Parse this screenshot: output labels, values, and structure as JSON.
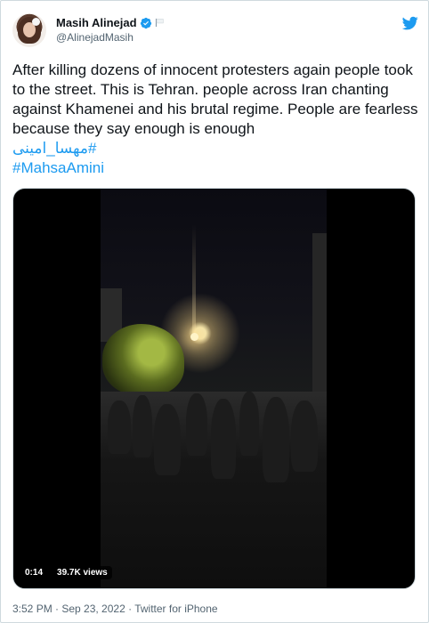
{
  "author": {
    "display_name": "Masih Alinejad",
    "handle": "@AlinejadMasih",
    "verified": true
  },
  "tweet": {
    "text": "After killing dozens of innocent protesters again people took to the street. This is Tehran. people across Iran chanting against Khamenei and his brutal regime. People are fearless because they say enough is enough",
    "hashtags": [
      "#مهسا_امینی",
      "#MahsaAmini"
    ]
  },
  "media": {
    "duration": "0:14",
    "views": "39.7K views"
  },
  "footer": {
    "timestamp": "3:52 PM · Sep 23, 2022 · Twitter for iPhone"
  },
  "icons": {
    "verified": "verified-badge-icon",
    "flag": "white-flag-icon",
    "brand": "twitter-bird-icon"
  },
  "colors": {
    "accent": "#1d9bf0",
    "text": "#0f1419",
    "muted": "#536471"
  }
}
